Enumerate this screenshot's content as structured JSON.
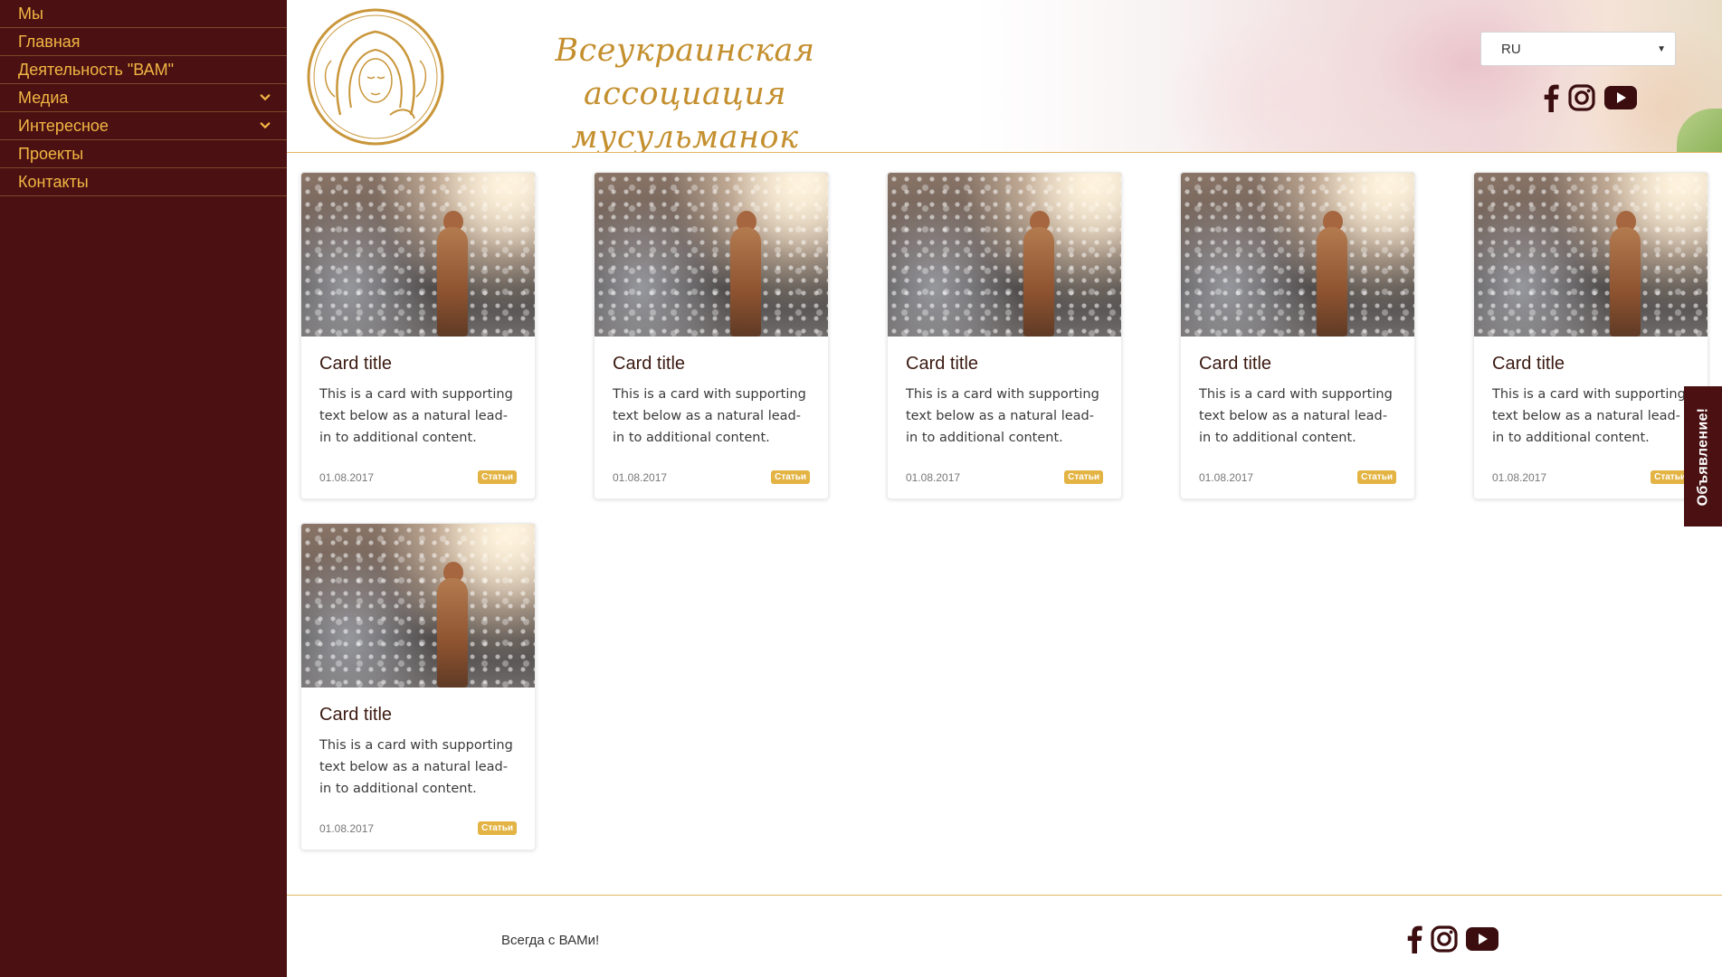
{
  "sidebar": {
    "items": [
      {
        "label": "Мы",
        "has_submenu": false
      },
      {
        "label": "Главная",
        "has_submenu": false
      },
      {
        "label": "Деятельность \"ВАМ\"",
        "has_submenu": false
      },
      {
        "label": "Медиа",
        "has_submenu": true
      },
      {
        "label": "Интересное",
        "has_submenu": true
      },
      {
        "label": "Проекты",
        "has_submenu": false
      },
      {
        "label": "Контакты",
        "has_submenu": false
      }
    ]
  },
  "header": {
    "title_line1": "Всеукраинская ассоциация",
    "title_line2": "мусульманок",
    "language": "RU",
    "social_icons": [
      "facebook-icon",
      "instagram-icon",
      "youtube-icon"
    ]
  },
  "cards": [
    {
      "title": "Card title",
      "text": "This is a card with supporting text below as a natural lead-in to additional content.",
      "date": "01.08.2017",
      "badge": "Статьи"
    },
    {
      "title": "Card title",
      "text": "This is a card with supporting text below as a natural lead-in to additional content.",
      "date": "01.08.2017",
      "badge": "Статьи"
    },
    {
      "title": "Card title",
      "text": "This is a card with supporting text below as a natural lead-in to additional content.",
      "date": "01.08.2017",
      "badge": "Статьи"
    },
    {
      "title": "Card title",
      "text": "This is a card with supporting text below as a natural lead-in to additional content.",
      "date": "01.08.2017",
      "badge": "Статьи"
    },
    {
      "title": "Card title",
      "text": "This is a card with supporting text below as a natural lead-in to additional content.",
      "date": "01.08.2017",
      "badge": "Статьи"
    },
    {
      "title": "Card title",
      "text": "This is a card with supporting text below as a natural lead-in to additional content.",
      "date": "01.08.2017",
      "badge": "Статьи"
    }
  ],
  "announcement": {
    "label": "Объявление!"
  },
  "footer": {
    "text": "Всегда с ВАМи!",
    "social_icons": [
      "facebook-icon",
      "instagram-icon",
      "youtube-icon"
    ]
  },
  "colors": {
    "sidebar_bg": "#4a1012",
    "nav_text": "#f2b643",
    "accent_gold": "#c48f2e",
    "badge": "#e3b444"
  }
}
